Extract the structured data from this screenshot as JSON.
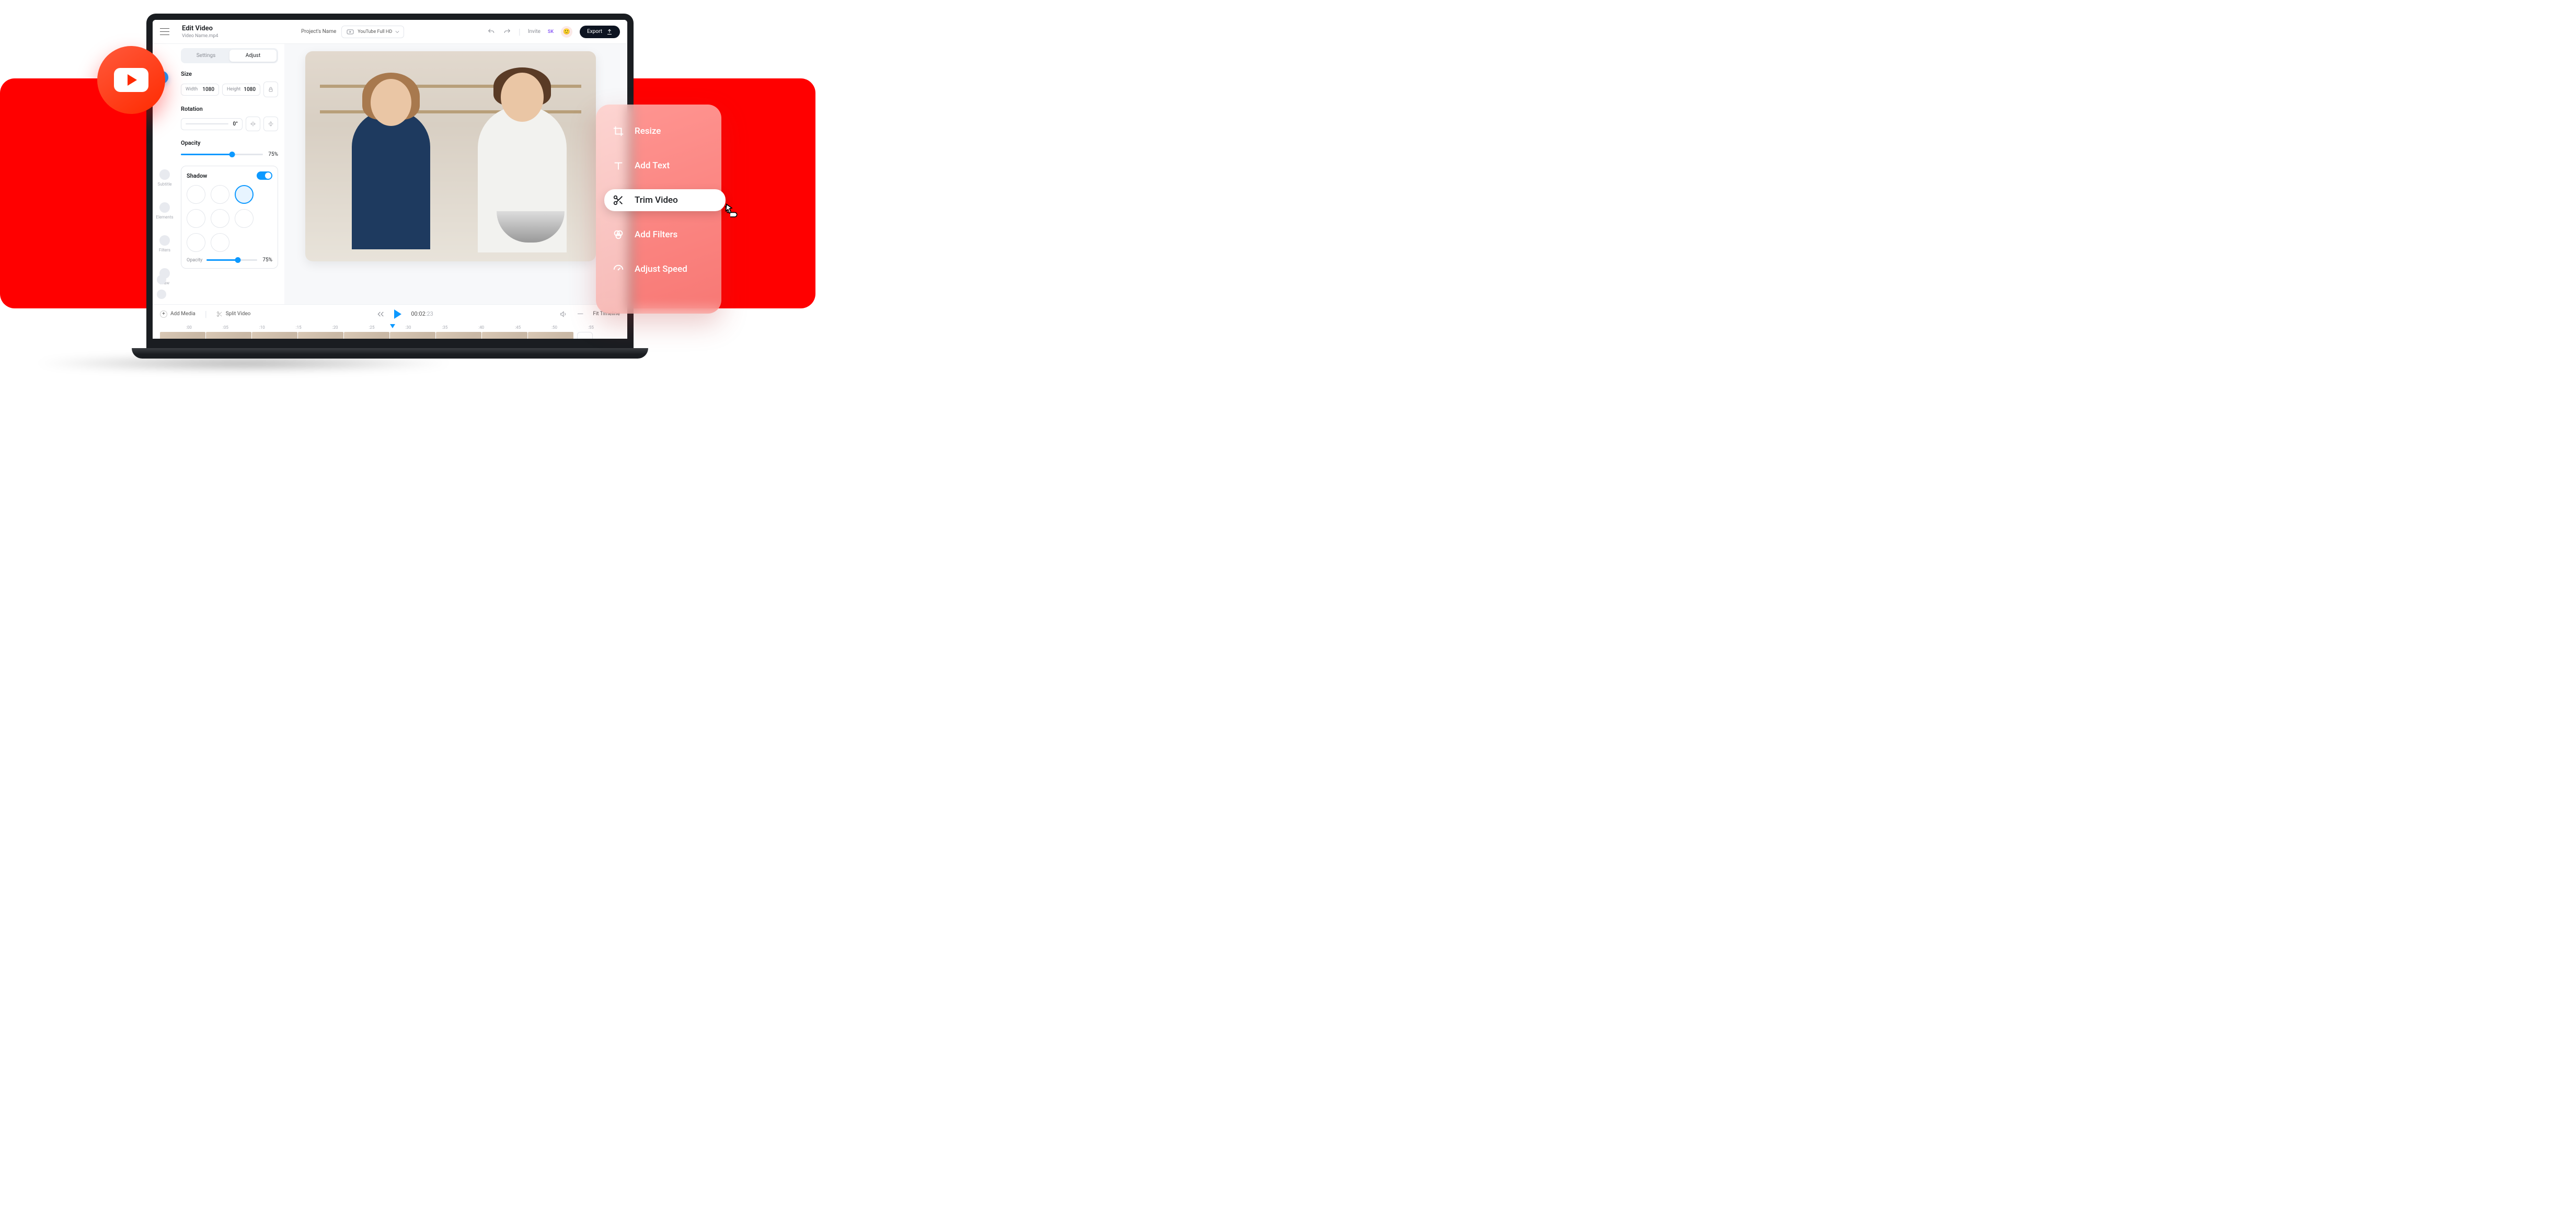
{
  "topbar": {
    "title": "Edit Video",
    "filename": "Video Name.mp4",
    "project_label": "Project's Name",
    "format_label": "YouTube Full HD",
    "invite": "Invite",
    "initials": "SK",
    "export": "Export"
  },
  "rail": {
    "subtitle": "Subtitle",
    "elements": "Elements",
    "filters": "Filters",
    "draw": "Draw"
  },
  "sidebar": {
    "tabs": {
      "settings": "Settings",
      "adjust": "Adjust"
    },
    "size": {
      "label": "Size",
      "width_label": "Width",
      "width_value": "1080",
      "height_label": "Height",
      "height_value": "1080"
    },
    "rotation": {
      "label": "Rotation",
      "degrees": "0°"
    },
    "opacity": {
      "label": "Opacity",
      "value": "75%"
    },
    "shadow": {
      "label": "Shadow",
      "opacity_label": "Opacity",
      "opacity_value": "75%"
    }
  },
  "controls": {
    "add_media": "Add Media",
    "split_video": "Split Video",
    "time": "00:02",
    "time_frames": ":23",
    "fit": "Fit Timeline"
  },
  "ruler": [
    ":00",
    ":05",
    ":10",
    ":15",
    ":20",
    ":25",
    ":30",
    ":35",
    ":40",
    ":45",
    ":50",
    ":55"
  ],
  "popover": {
    "resize": "Resize",
    "add_text": "Add Text",
    "trim": "Trim Video",
    "filters": "Add Filters",
    "speed": "Adjust Speed"
  }
}
